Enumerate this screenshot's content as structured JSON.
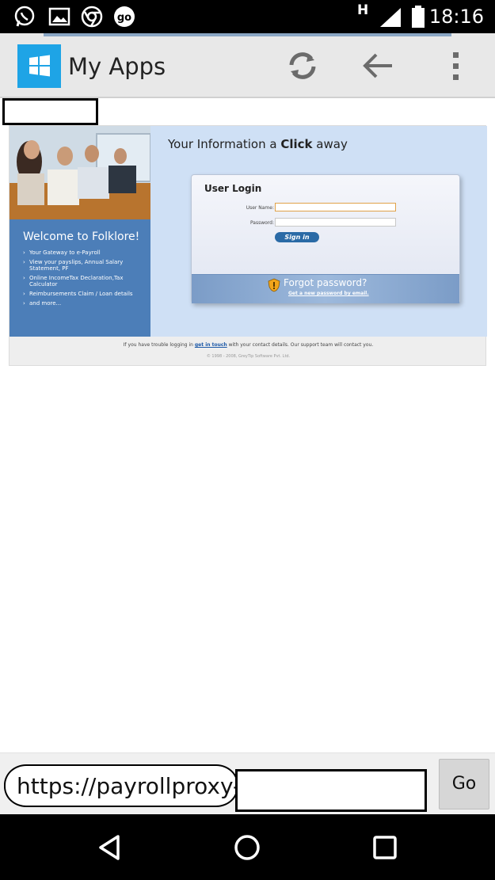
{
  "status_bar": {
    "time": "18:16",
    "network": "H",
    "icons": [
      "whatsapp-icon",
      "gallery-icon",
      "chrome-icon",
      "go-icon",
      "signal-icon",
      "battery-icon"
    ]
  },
  "app_bar": {
    "title": "My Apps",
    "icons": [
      "windows-logo-icon",
      "refresh-icon",
      "back-arrow-icon",
      "overflow-menu-icon"
    ]
  },
  "page": {
    "tagline_prefix": "Your Information a ",
    "tagline_bold": "Click",
    "tagline_suffix": " away",
    "welcome_title": "Welcome to Folklore!",
    "features": [
      "Your Gateway to e-Payroll",
      "View your payslips, Annual Salary Statement, PF",
      "Online IncomeTax Declaration,Tax Calculator",
      "Reimbursements Claim / Loan details",
      "and more..."
    ],
    "login": {
      "title": "User Login",
      "username_label": "User Name:",
      "username_value": "",
      "password_label": "Password:",
      "password_value": "",
      "signin_label": "Sign in",
      "forgot_title": "Forgot password?",
      "forgot_link": "Get a new password by email."
    },
    "footer": {
      "trouble_prefix": "If you have trouble logging in ",
      "trouble_link": "get in touch",
      "trouble_suffix": " with your contact details. Our support team will contact you.",
      "copyright": "© 1998 - 2008, GreyTip Software Pvt. Ltd."
    }
  },
  "url_bar": {
    "url": "https://payrollproxy-",
    "go_label": "Go"
  },
  "nav_bar": {
    "icons": [
      "nav-back-icon",
      "nav-home-icon",
      "nav-recents-icon"
    ]
  },
  "colors": {
    "status_bg": "#000000",
    "appbar_bg": "#e8e8e8",
    "accent_windows": "#1ea4e6",
    "panel_blue": "#4c7eb8",
    "login_bg": "#cfe0f5"
  }
}
